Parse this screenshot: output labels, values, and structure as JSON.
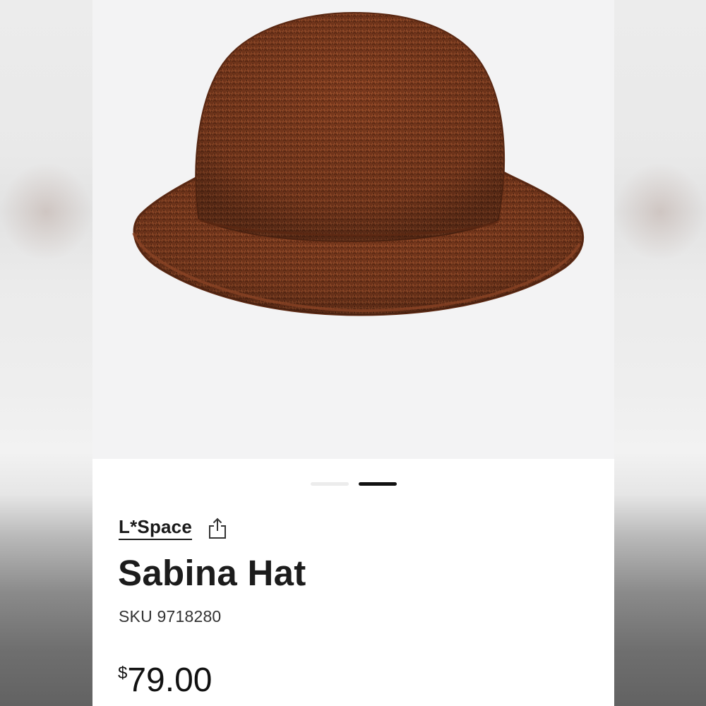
{
  "product": {
    "brand": "L*Space",
    "name": "Sabina Hat",
    "sku": "SKU 9718280",
    "currency_symbol": "$",
    "price": "79.00",
    "image_alt": "Brown crochet straw bucket hat"
  },
  "carousel": {
    "slide_count": 2,
    "active_index": 1
  },
  "icons": {
    "share": "share-icon"
  },
  "colors": {
    "hat_brown": "#7b3a1e",
    "active_indicator": "#111111",
    "inactive_indicator": "#ececec",
    "image_background": "#f3f3f4"
  }
}
